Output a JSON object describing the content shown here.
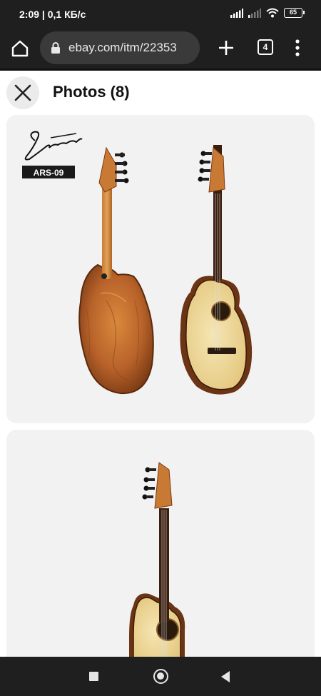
{
  "status_bar": {
    "time": "2:09 | 0,1 КБ/с",
    "battery": "65"
  },
  "browser": {
    "url": "ebay.com/itm/22353",
    "tab_count": "4"
  },
  "gallery": {
    "title": "Photos (8)",
    "photo1": {
      "brand_logo": "Smiger",
      "model_badge": "ARS-09"
    }
  },
  "icons": {
    "home": "home-icon",
    "lock": "lock-icon",
    "new_tab": "plus-icon",
    "tabs": "tabs-icon",
    "menu": "more-vert-icon",
    "close": "close-icon",
    "nav_recents": "square-icon",
    "nav_home": "circle-icon",
    "nav_back": "triangle-back-icon"
  },
  "colors": {
    "chrome_bg": "#1f1f1f",
    "url_pill": "#3a3a3a",
    "card_bg": "#f2f2f2",
    "close_bg": "#ebebeb"
  }
}
